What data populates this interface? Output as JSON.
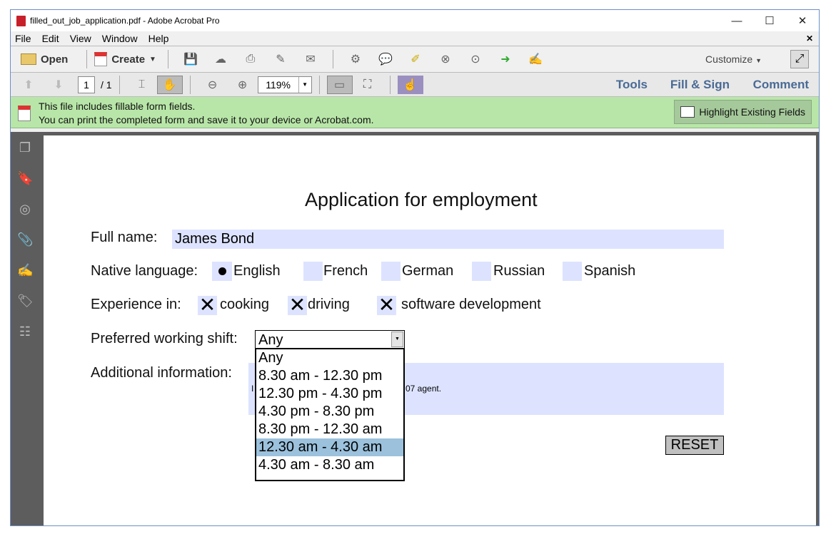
{
  "window": {
    "title": "filled_out_job_application.pdf - Adobe Acrobat Pro"
  },
  "menu": [
    "File",
    "Edit",
    "View",
    "Window",
    "Help"
  ],
  "toolbar": {
    "open": "Open",
    "create": "Create",
    "customize": "Customize"
  },
  "nav": {
    "page": "1",
    "total": "/ 1",
    "zoom": "119%",
    "tools": "Tools",
    "fill_sign": "Fill & Sign",
    "comment": "Comment"
  },
  "notice": {
    "line1": "This file includes fillable form fields.",
    "line2": "You can print the completed form and save it to your device or Acrobat.com.",
    "highlight": "Highlight Existing Fields"
  },
  "form": {
    "title": "Application for employment",
    "full_name_label": "Full name:",
    "full_name": "James Bond",
    "lang_label": "Native language:",
    "languages": [
      "English",
      "French",
      "German",
      "Russian",
      "Spanish"
    ],
    "selected_language": "English",
    "exp_label": "Experience in:",
    "experience": [
      "cooking",
      "driving",
      "software development"
    ],
    "experience_checked": [
      true,
      true,
      true
    ],
    "shift_label": "Preferred working shift:",
    "shift_value": "Any",
    "shift_options": [
      "Any",
      "8.30 am - 12.30 pm",
      "12.30 pm - 4.30 pm",
      "4.30 pm - 8.30 pm",
      "8.30 pm - 12.30 am",
      "12.30 am - 4.30 am",
      "4.30 am - 8.30 am"
    ],
    "shift_highlighted": "12.30 am - 4.30 am",
    "info_label": "Additional information:",
    "info_start": "I",
    "info_end": "07 agent.",
    "reset": "RESET"
  }
}
